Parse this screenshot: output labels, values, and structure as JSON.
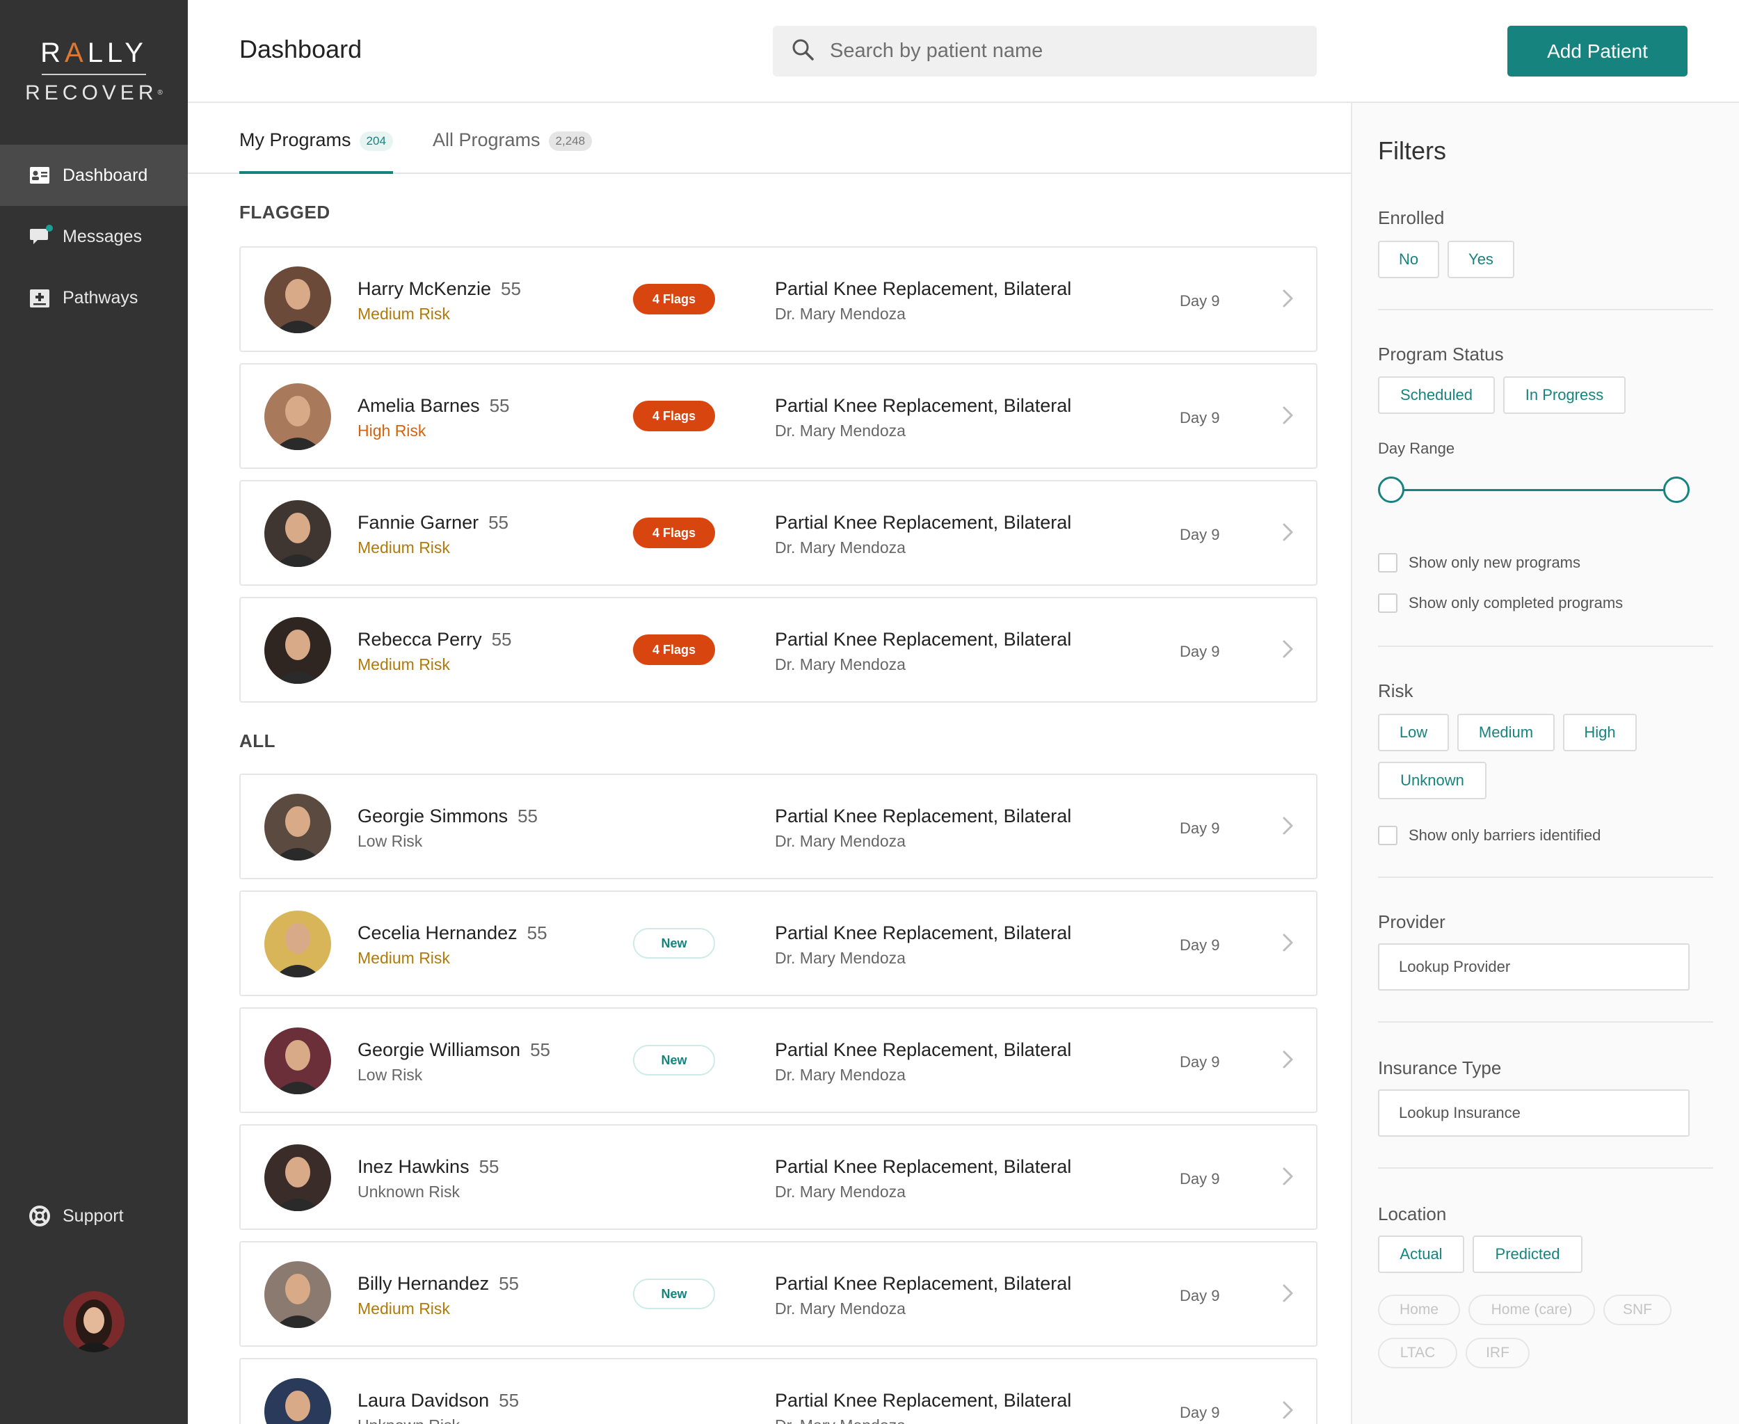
{
  "sidebar": {
    "logo_top_1": "R",
    "logo_top_accent": "A",
    "logo_top_2": "LLY",
    "logo_bottom": "RECOVER",
    "logo_reg": "®",
    "nav": [
      {
        "label": "Dashboard",
        "icon": "id-card-icon",
        "active": true
      },
      {
        "label": "Messages",
        "icon": "chat-bubble-icon",
        "active": false
      },
      {
        "label": "Pathways",
        "icon": "medical-kit-icon",
        "active": false
      }
    ],
    "support_label": "Support"
  },
  "header": {
    "title": "Dashboard",
    "search_placeholder": "Search by patient name",
    "add_button": "Add Patient"
  },
  "tabs": [
    {
      "label": "My Programs",
      "count": "204"
    },
    {
      "label": "All Programs",
      "count": "2,248"
    }
  ],
  "sections": {
    "flagged": "FLAGGED",
    "all": "ALL"
  },
  "flagged_patients": [
    {
      "name": "Harry McKenzie",
      "age": "55",
      "risk": "Medium Risk",
      "risk_level": "medium",
      "badge": "4 Flags",
      "badge_type": "flags",
      "procedure": "Partial Knee Replacement, Bilateral",
      "doctor": "Dr. Mary Mendoza",
      "day": "Day 9",
      "avatar_color": "#6b4a3a"
    },
    {
      "name": "Amelia Barnes",
      "age": "55",
      "risk": "High Risk",
      "risk_level": "high",
      "badge": "4 Flags",
      "badge_type": "flags",
      "procedure": "Partial Knee Replacement, Bilateral",
      "doctor": "Dr. Mary Mendoza",
      "day": "Day 9",
      "avatar_color": "#a8795a"
    },
    {
      "name": "Fannie Garner",
      "age": "55",
      "risk": "Medium Risk",
      "risk_level": "medium",
      "badge": "4 Flags",
      "badge_type": "flags",
      "procedure": "Partial Knee Replacement, Bilateral",
      "doctor": "Dr. Mary Mendoza",
      "day": "Day 9",
      "avatar_color": "#3f3632"
    },
    {
      "name": "Rebecca Perry",
      "age": "55",
      "risk": "Medium Risk",
      "risk_level": "medium",
      "badge": "4 Flags",
      "badge_type": "flags",
      "procedure": "Partial Knee Replacement, Bilateral",
      "doctor": "Dr. Mary Mendoza",
      "day": "Day 9",
      "avatar_color": "#2f2622"
    }
  ],
  "all_patients": [
    {
      "name": "Georgie Simmons",
      "age": "55",
      "risk": "Low Risk",
      "risk_level": "low",
      "badge": "",
      "badge_type": "none",
      "procedure": "Partial Knee Replacement, Bilateral",
      "doctor": "Dr. Mary Mendoza",
      "day": "Day 9",
      "avatar_color": "#5a4a40"
    },
    {
      "name": "Cecelia Hernandez",
      "age": "55",
      "risk": "Medium Risk",
      "risk_level": "medium",
      "badge": "New",
      "badge_type": "new",
      "procedure": "Partial Knee Replacement, Bilateral",
      "doctor": "Dr. Mary Mendoza",
      "day": "Day 9",
      "avatar_color": "#d9b55a"
    },
    {
      "name": "Georgie Williamson",
      "age": "55",
      "risk": "Low Risk",
      "risk_level": "low",
      "badge": "New",
      "badge_type": "new",
      "procedure": "Partial Knee Replacement, Bilateral",
      "doctor": "Dr. Mary Mendoza",
      "day": "Day 9",
      "avatar_color": "#6b2f3a"
    },
    {
      "name": "Inez Hawkins",
      "age": "55",
      "risk": "Unknown Risk",
      "risk_level": "unknown",
      "badge": "",
      "badge_type": "none",
      "procedure": "Partial Knee Replacement, Bilateral",
      "doctor": "Dr. Mary Mendoza",
      "day": "Day 9",
      "avatar_color": "#3a2c28"
    },
    {
      "name": "Billy Hernandez",
      "age": "55",
      "risk": "Medium Risk",
      "risk_level": "medium",
      "badge": "New",
      "badge_type": "new",
      "procedure": "Partial Knee Replacement, Bilateral",
      "doctor": "Dr. Mary Mendoza",
      "day": "Day 9",
      "avatar_color": "#8a7a70"
    },
    {
      "name": "Laura Davidson",
      "age": "55",
      "risk": "Unknown Risk",
      "risk_level": "unknown",
      "badge": "",
      "badge_type": "none",
      "procedure": "Partial Knee Replacement, Bilateral",
      "doctor": "Dr. Mary Mendoza",
      "day": "Day 9",
      "avatar_color": "#2a3a5a"
    }
  ],
  "filters": {
    "title": "Filters",
    "enrolled_label": "Enrolled",
    "enrolled_options": [
      "No",
      "Yes"
    ],
    "status_label": "Program Status",
    "status_options": [
      "Scheduled",
      "In Progress"
    ],
    "day_range_label": "Day Range",
    "show_new": "Show only new programs",
    "show_completed": "Show only completed programs",
    "risk_label": "Risk",
    "risk_options": [
      "Low",
      "Medium",
      "High",
      "Unknown"
    ],
    "show_barriers": "Show only barriers identified",
    "provider_label": "Provider",
    "provider_placeholder": "Lookup Provider",
    "insurance_label": "Insurance Type",
    "insurance_placeholder": "Lookup Insurance",
    "location_label": "Location",
    "location_options": [
      "Actual",
      "Predicted"
    ],
    "location_types": [
      "Home",
      "Home (care)",
      "SNF",
      "LTAC",
      "IRF"
    ]
  },
  "colors": {
    "accent": "#17837f",
    "flag": "#d9450f",
    "sidebar": "#333333",
    "medium_risk": "#b07a0a",
    "high_risk": "#d5620f"
  }
}
